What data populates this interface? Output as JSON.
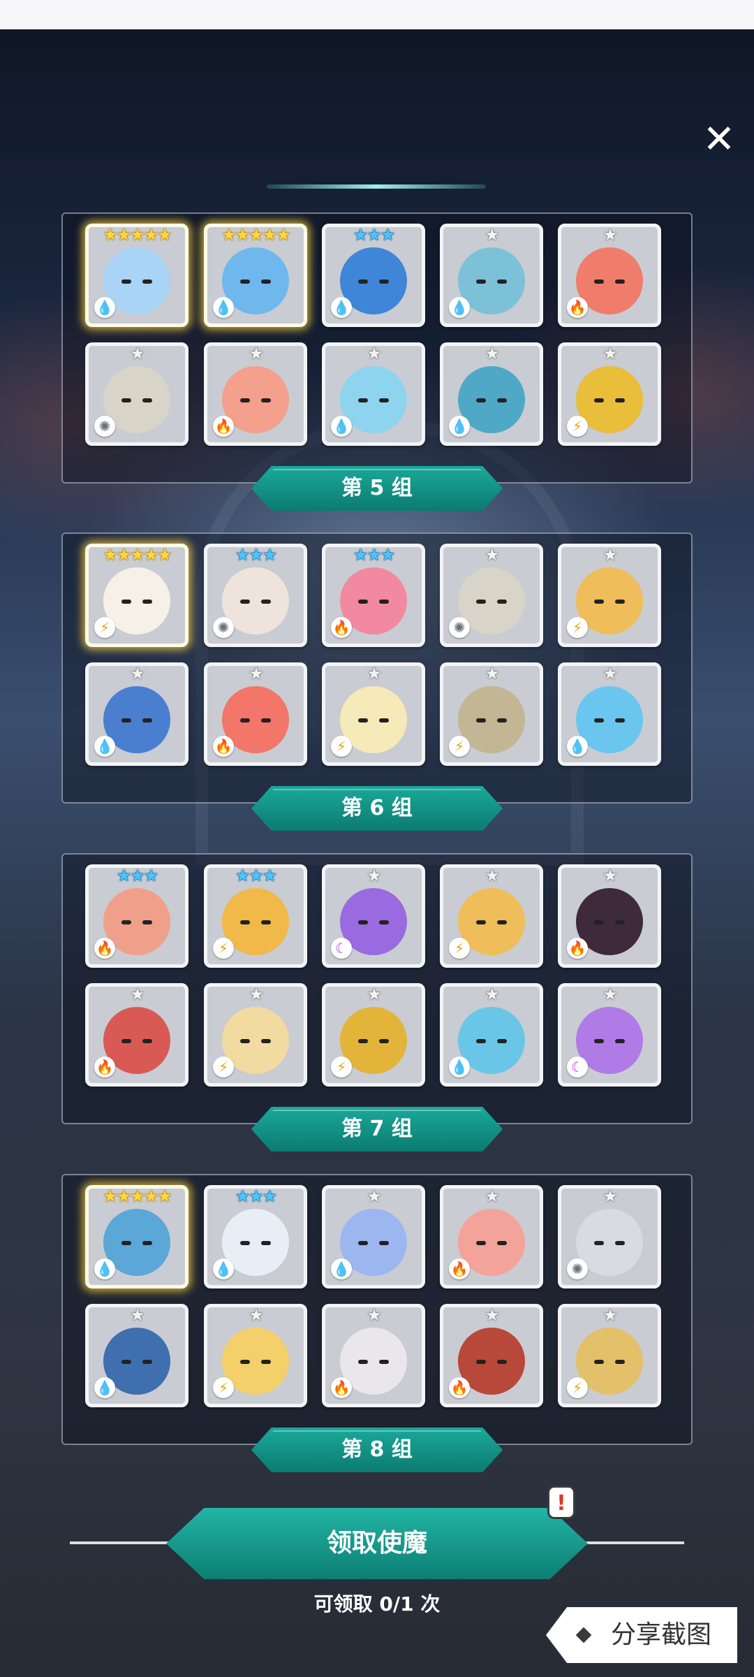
{
  "close_label": "✕",
  "groups": [
    {
      "label": "第 5 组",
      "cards": [
        {
          "stars": "★★★★★",
          "tier": "s5",
          "element": "water",
          "glyph": "💧",
          "color": "#a9d4f5",
          "gold": true
        },
        {
          "stars": "★★★★★",
          "tier": "s5",
          "element": "water",
          "glyph": "💧",
          "color": "#6fb8ee",
          "gold": true
        },
        {
          "stars": "★★★",
          "tier": "s3",
          "element": "water",
          "glyph": "💧",
          "color": "#3f86d8",
          "gold": false
        },
        {
          "stars": "★",
          "tier": "s1",
          "element": "water",
          "glyph": "💧",
          "color": "#7cc1d8",
          "gold": false
        },
        {
          "stars": "★",
          "tier": "s1",
          "element": "fire",
          "glyph": "🔥",
          "color": "#f07d6b",
          "gold": false
        },
        {
          "stars": "★",
          "tier": "s1",
          "element": "light",
          "glyph": "✺",
          "color": "#d9d4c8",
          "gold": false
        },
        {
          "stars": "★",
          "tier": "s1",
          "element": "fire",
          "glyph": "🔥",
          "color": "#f3a08c",
          "gold": false
        },
        {
          "stars": "★",
          "tier": "s1",
          "element": "water",
          "glyph": "💧",
          "color": "#8fd4ee",
          "gold": false
        },
        {
          "stars": "★",
          "tier": "s1",
          "element": "water",
          "glyph": "💧",
          "color": "#4fa9c6",
          "gold": false
        },
        {
          "stars": "★",
          "tier": "s1",
          "element": "thunder",
          "glyph": "⚡",
          "color": "#e8be3a",
          "gold": false
        }
      ]
    },
    {
      "label": "第 6 组",
      "cards": [
        {
          "stars": "★★★★★",
          "tier": "s5",
          "element": "thunder",
          "glyph": "⚡",
          "color": "#f7f0e6",
          "gold": true
        },
        {
          "stars": "★★★",
          "tier": "s3",
          "element": "light",
          "glyph": "✺",
          "color": "#efe4dc",
          "gold": false
        },
        {
          "stars": "★★★",
          "tier": "s3",
          "element": "fire",
          "glyph": "🔥",
          "color": "#f18aa0",
          "gold": false
        },
        {
          "stars": "★",
          "tier": "s1",
          "element": "light",
          "glyph": "✺",
          "color": "#d9d4c8",
          "gold": false
        },
        {
          "stars": "★",
          "tier": "s1",
          "element": "thunder",
          "glyph": "⚡",
          "color": "#efbe5a",
          "gold": false
        },
        {
          "stars": "★",
          "tier": "s1",
          "element": "water",
          "glyph": "💧",
          "color": "#4a7fd0",
          "gold": false
        },
        {
          "stars": "★",
          "tier": "s1",
          "element": "fire",
          "glyph": "🔥",
          "color": "#f2766a",
          "gold": false
        },
        {
          "stars": "★",
          "tier": "s1",
          "element": "thunder",
          "glyph": "⚡",
          "color": "#f6eab8",
          "gold": false
        },
        {
          "stars": "★",
          "tier": "s1",
          "element": "thunder",
          "glyph": "⚡",
          "color": "#c2b694",
          "gold": false
        },
        {
          "stars": "★",
          "tier": "s1",
          "element": "water",
          "glyph": "💧",
          "color": "#6ac6ee",
          "gold": false
        }
      ]
    },
    {
      "label": "第 7 组",
      "cards": [
        {
          "stars": "★★★",
          "tier": "s3",
          "element": "fire",
          "glyph": "🔥",
          "color": "#f0a08a",
          "gold": false
        },
        {
          "stars": "★★★",
          "tier": "s3",
          "element": "thunder",
          "glyph": "⚡",
          "color": "#f1b84a",
          "gold": false
        },
        {
          "stars": "★",
          "tier": "s1",
          "element": "dark",
          "glyph": "☾",
          "color": "#9a6ae0",
          "gold": false
        },
        {
          "stars": "★",
          "tier": "s1",
          "element": "thunder",
          "glyph": "⚡",
          "color": "#efbe5a",
          "gold": false
        },
        {
          "stars": "★",
          "tier": "s1",
          "element": "fire",
          "glyph": "🔥",
          "color": "#3e2a3a",
          "gold": false
        },
        {
          "stars": "★",
          "tier": "s1",
          "element": "fire",
          "glyph": "🔥",
          "color": "#d95a55",
          "gold": false
        },
        {
          "stars": "★",
          "tier": "s1",
          "element": "thunder",
          "glyph": "⚡",
          "color": "#f1dba0",
          "gold": false
        },
        {
          "stars": "★",
          "tier": "s1",
          "element": "thunder",
          "glyph": "⚡",
          "color": "#e2b53a",
          "gold": false
        },
        {
          "stars": "★",
          "tier": "s1",
          "element": "water",
          "glyph": "💧",
          "color": "#6ac6e6",
          "gold": false
        },
        {
          "stars": "★",
          "tier": "s1",
          "element": "dark",
          "glyph": "☾",
          "color": "#b07be6",
          "gold": false
        }
      ]
    },
    {
      "label": "第 8 组",
      "cards": [
        {
          "stars": "★★★★★",
          "tier": "s5",
          "element": "water",
          "glyph": "💧",
          "color": "#5aa7d8",
          "gold": true
        },
        {
          "stars": "★★★",
          "tier": "s3",
          "element": "water",
          "glyph": "💧",
          "color": "#e8eef6",
          "gold": false
        },
        {
          "stars": "★",
          "tier": "s1",
          "element": "water",
          "glyph": "💧",
          "color": "#9cb6f0",
          "gold": false
        },
        {
          "stars": "★",
          "tier": "s1",
          "element": "fire",
          "glyph": "🔥",
          "color": "#f4a39a",
          "gold": false
        },
        {
          "stars": "★",
          "tier": "s1",
          "element": "light",
          "glyph": "✺",
          "color": "#d8dbe2",
          "gold": false
        },
        {
          "stars": "★",
          "tier": "s1",
          "element": "water",
          "glyph": "💧",
          "color": "#3f6fae",
          "gold": false
        },
        {
          "stars": "★",
          "tier": "s1",
          "element": "thunder",
          "glyph": "⚡",
          "color": "#f3d06a",
          "gold": false
        },
        {
          "stars": "★",
          "tier": "s1",
          "element": "fire",
          "glyph": "🔥",
          "color": "#e9e6ec",
          "gold": false
        },
        {
          "stars": "★",
          "tier": "s1",
          "element": "fire",
          "glyph": "🔥",
          "color": "#b8483a",
          "gold": false
        },
        {
          "stars": "★",
          "tier": "s1",
          "element": "thunder",
          "glyph": "⚡",
          "color": "#e3c06a",
          "gold": false
        }
      ]
    }
  ],
  "claim": {
    "button_label": "领取使魔",
    "alert_glyph": "!",
    "count_text": "可领取 0/1 次"
  },
  "share": {
    "label": "分享截图"
  }
}
